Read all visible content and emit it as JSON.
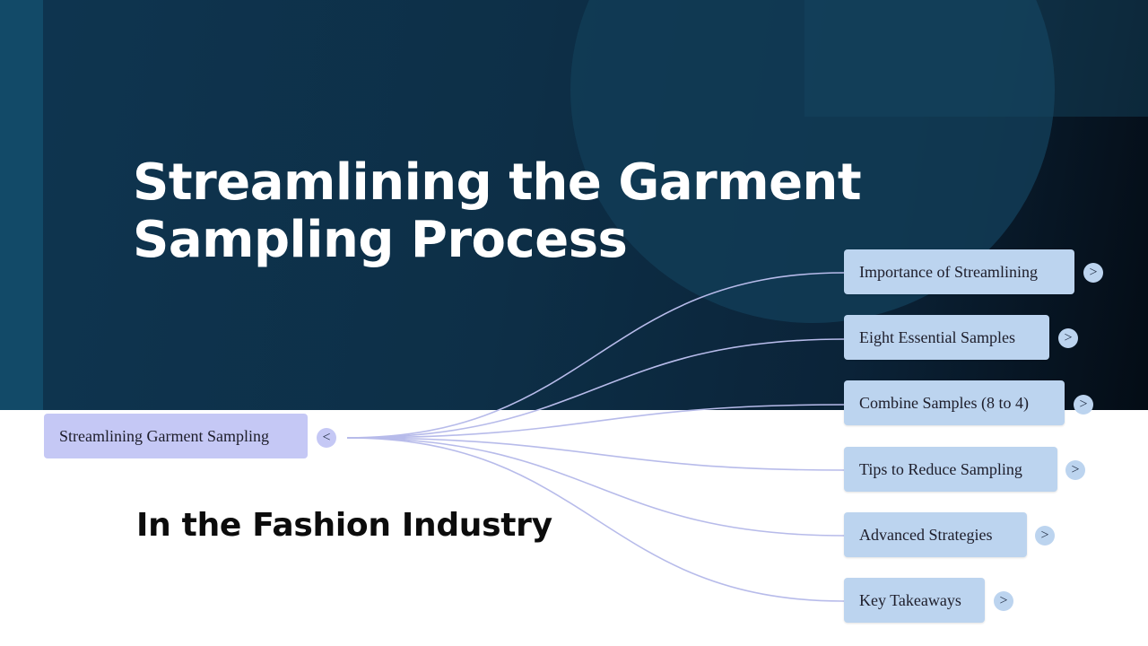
{
  "slide": {
    "title": "Streamlining the Garment Sampling Process",
    "subtitle": "In the Fashion Industry"
  },
  "mindmap": {
    "root": {
      "label": "Streamlining Garment Sampling",
      "toggle": "<"
    },
    "branches": [
      {
        "label": "Importance of Streamlining",
        "toggle": ">"
      },
      {
        "label": "Eight Essential Samples",
        "toggle": ">"
      },
      {
        "label": "Combine Samples (8 to 4)",
        "toggle": ">"
      },
      {
        "label": "Tips to Reduce Sampling",
        "toggle": ">"
      },
      {
        "label": "Advanced Strategies",
        "toggle": ">"
      },
      {
        "label": "Key Takeaways",
        "toggle": ">"
      }
    ]
  },
  "colors": {
    "hero_background": "#0d2f47",
    "root_node": "#c5c8f5",
    "branch_node": "#bcd4ef",
    "connector": "#b7bbea"
  }
}
